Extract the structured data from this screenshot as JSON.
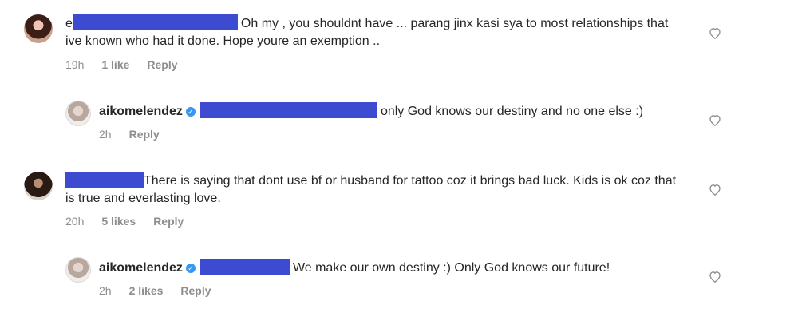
{
  "comments": [
    {
      "handle_initial": "e",
      "text": "Oh my , you shouldnt have ... parang jinx kasi sya to most relationships that ive known who had it done. Hope youre an exemption ..",
      "time": "19h",
      "likes": "1 like",
      "reply": "Reply",
      "avatar": "commenter-avatar-1"
    },
    {
      "username": "aikomelendez",
      "text": "only God knows our destiny and no one else :)",
      "time": "2h",
      "likes": "",
      "reply": "Reply",
      "avatar": "aikomelendez-avatar"
    },
    {
      "text": "There is saying that dont use  bf or husband for tattoo coz it brings bad luck. Kids is ok coz that is true and everlasting  love.",
      "time": "20h",
      "likes": "5 likes",
      "reply": "Reply",
      "avatar": "commenter-avatar-2"
    },
    {
      "username": "aikomelendez",
      "text": "We make our own destiny :) Only God knows our future!",
      "time": "2h",
      "likes": "2 likes",
      "reply": "Reply",
      "avatar": "aikomelendez-avatar"
    }
  ],
  "colors": {
    "redaction": "#3d4bd0",
    "verified": "#3897f0",
    "meta": "#8e8e8e"
  },
  "icons": {
    "like": "heart-outline-icon",
    "verified": "verified-badge-icon"
  }
}
